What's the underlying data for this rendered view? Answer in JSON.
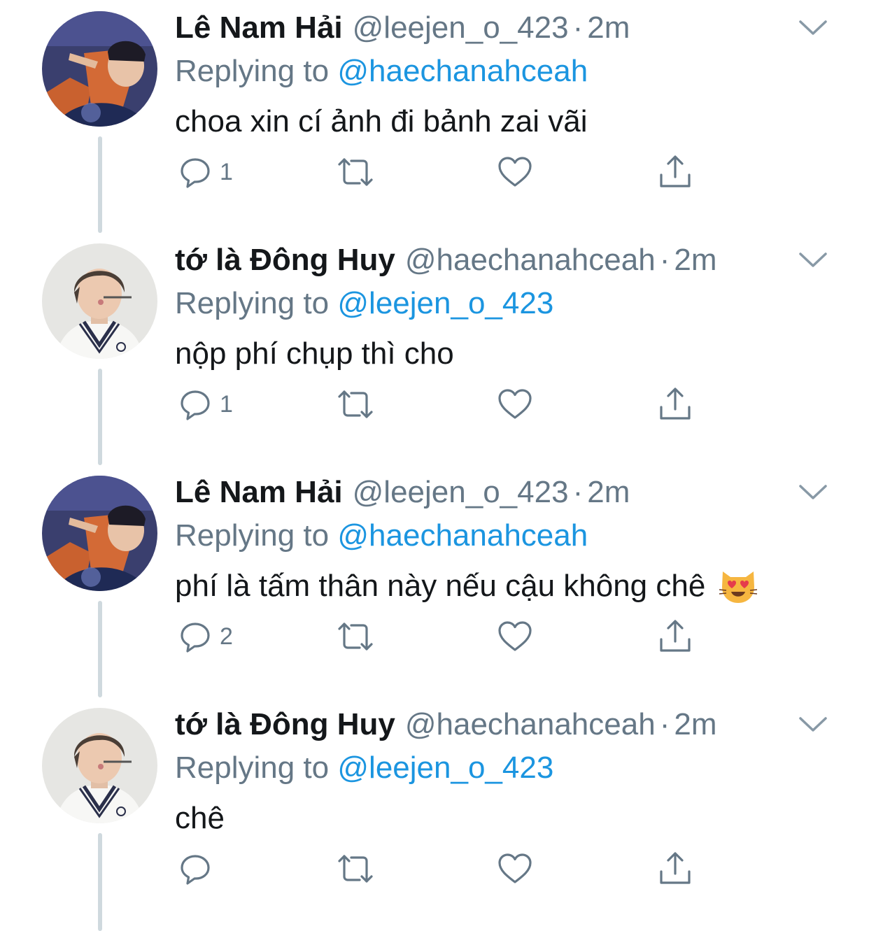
{
  "tweets": [
    {
      "name": "Lê Nam Hải",
      "handle": "@leejen_o_423",
      "dot": "·",
      "time": "2m",
      "replying_prefix": "Replying to",
      "replying_mention": "@haechanahceah",
      "text": "choa xin cí ảnh đi bảnh zai vãi",
      "reply_count": "1",
      "avatar": "avatar-orange-shirt"
    },
    {
      "name": "tớ là Đông Huy",
      "handle": "@haechanahceah",
      "dot": "·",
      "time": "2m",
      "replying_prefix": "Replying to",
      "replying_mention": "@leejen_o_423",
      "text": "nộp phí chụp thì cho",
      "reply_count": "1",
      "avatar": "avatar-white-sweater"
    },
    {
      "name": "Lê Nam Hải",
      "handle": "@leejen_o_423",
      "dot": "·",
      "time": "2m",
      "replying_prefix": "Replying to",
      "replying_mention": "@haechanahceah",
      "text": "phí là tấm thân này nếu cậu không chê",
      "reply_count": "2",
      "emoji": "heart-eyes-cat-emoji",
      "avatar": "avatar-orange-shirt"
    },
    {
      "name": "tớ là Đông Huy",
      "handle": "@haechanahceah",
      "dot": "·",
      "time": "2m",
      "replying_prefix": "Replying to",
      "replying_mention": "@leejen_o_423",
      "text": "chê",
      "reply_count": "",
      "avatar": "avatar-white-sweater"
    }
  ],
  "icons": {
    "reply": "reply-icon",
    "retweet": "retweet-icon",
    "like": "like-icon",
    "share": "share-icon",
    "caret": "chevron-down-icon"
  },
  "colors": {
    "text": "#14171a",
    "secondary": "#657786",
    "mention": "#1b95e0",
    "thread_line": "#cfd9de"
  }
}
